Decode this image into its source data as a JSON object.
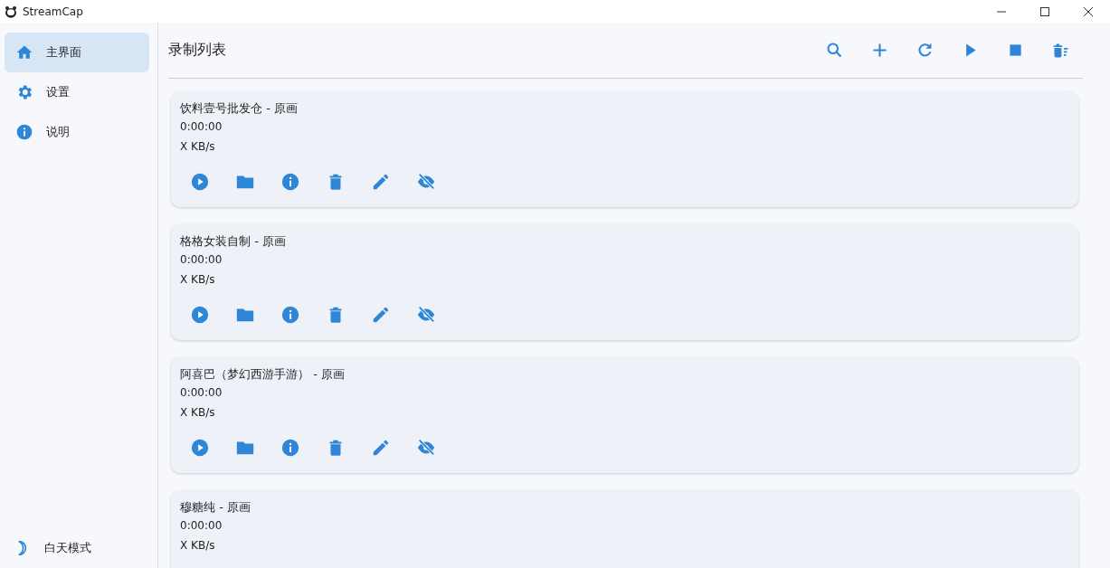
{
  "window": {
    "title": "StreamCap"
  },
  "sidebar": {
    "items": [
      {
        "label": "主界面",
        "selected": true
      },
      {
        "label": "设置",
        "selected": false
      },
      {
        "label": "说明",
        "selected": false
      }
    ],
    "theme_toggle": {
      "label": "白天模式"
    }
  },
  "header": {
    "title": "录制列表"
  },
  "recordings": [
    {
      "title": "饮料壹号批发仓 - 原画",
      "duration": "0:00:00",
      "speed": "X KB/s"
    },
    {
      "title": "格格女装自制 - 原画",
      "duration": "0:00:00",
      "speed": "X KB/s"
    },
    {
      "title": "阿喜巴（梦幻西游手游） - 原画",
      "duration": "0:00:00",
      "speed": "X KB/s"
    },
    {
      "title": "穆糖纯 - 原画",
      "duration": "0:00:00",
      "speed": "X KB/s"
    }
  ]
}
